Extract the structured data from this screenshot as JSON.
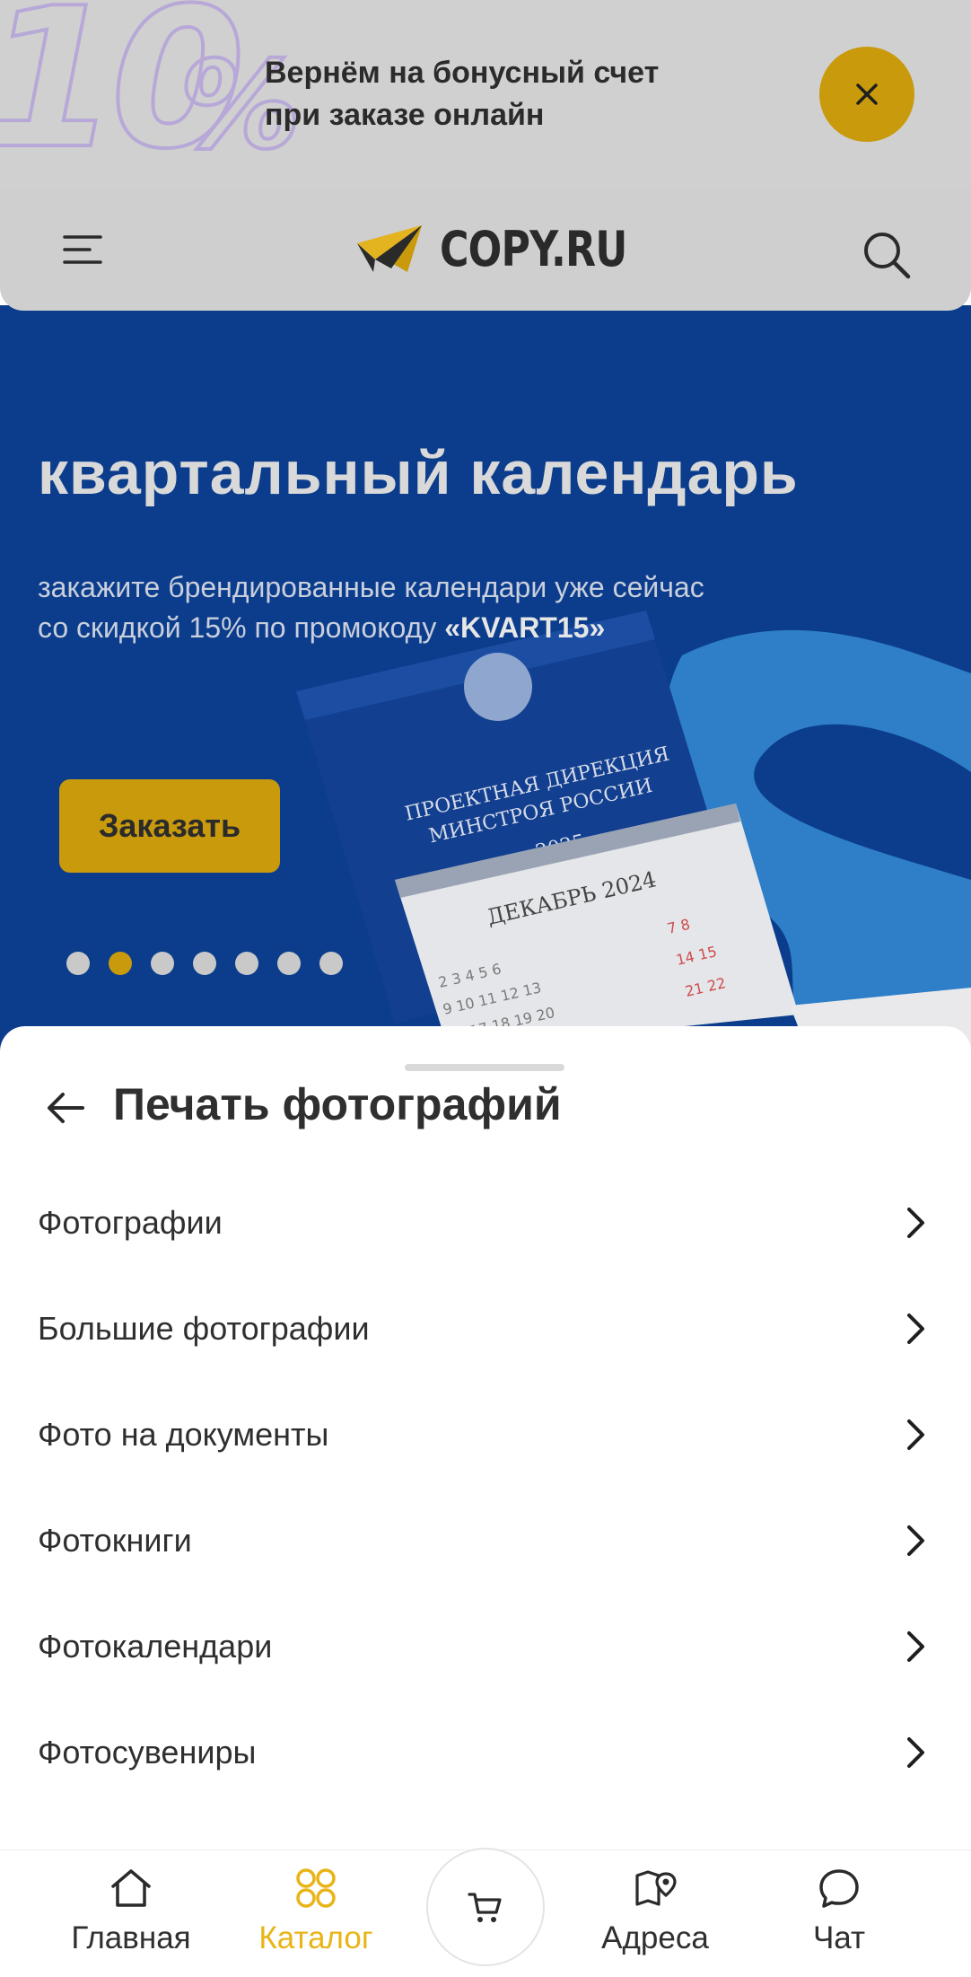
{
  "promo": {
    "badge_number": "10",
    "badge_percent": "%",
    "line1": "Вернём на бонусный счет",
    "line2": "при заказе онлайн",
    "accent_color": "#c89a0c"
  },
  "header": {
    "logo_text": "COPY.RU",
    "menu_icon": "menu-icon",
    "search_icon": "search-icon"
  },
  "banner": {
    "title": "квартальный календарь",
    "subtitle_line1": "закажите брендированные календари уже сейчас",
    "subtitle_line2_prefix": "со скидкой 15% по промокоду ",
    "promo_code": "«KVART15»",
    "button_label": "Заказать",
    "slides_total": 7,
    "active_slide": 2,
    "product": {
      "line1": "ПРОЕКТНАЯ ДИРЕКЦИЯ",
      "line2": "МИНСТРОЯ РОССИИ",
      "year": "2025",
      "month": "ДЕКАБРЬ 2024"
    },
    "background_color": "#0b3d8c"
  },
  "sheet": {
    "title": "Печать фотографий",
    "items": [
      {
        "label": "Фотографии"
      },
      {
        "label": "Большие фотографии"
      },
      {
        "label": "Фото на документы"
      },
      {
        "label": "Фотокниги"
      },
      {
        "label": "Фотокалендари"
      },
      {
        "label": "Фотосувениры"
      }
    ]
  },
  "tabbar": {
    "home": "Главная",
    "catalog": "Каталог",
    "addresses": "Адреса",
    "chat": "Чат",
    "active_tab": "catalog",
    "active_color": "#e8b416"
  }
}
